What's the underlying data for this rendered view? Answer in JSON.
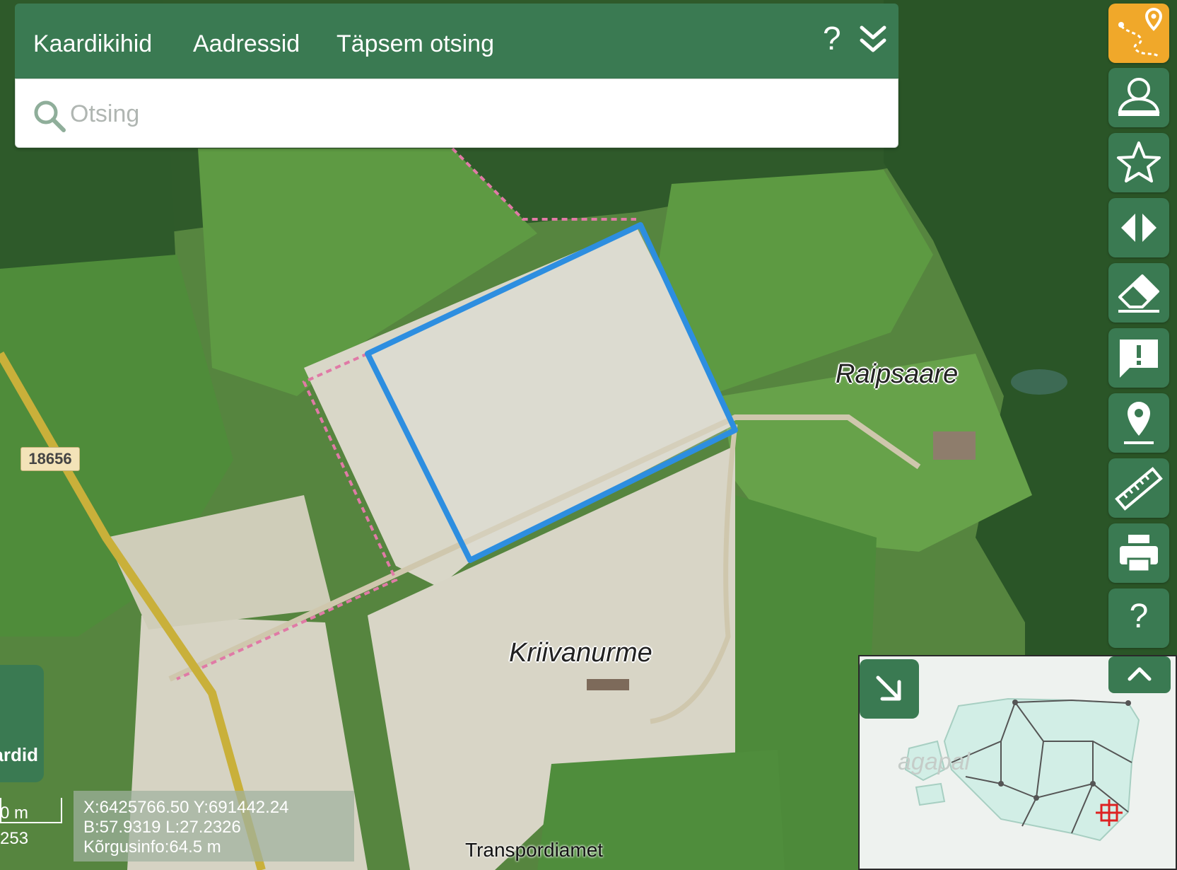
{
  "header": {
    "tabs": [
      {
        "label": "Kaardikihid"
      },
      {
        "label": "Aadressid"
      },
      {
        "label": "Täpsem otsing"
      }
    ],
    "help_label": "?"
  },
  "search": {
    "placeholder": "Otsing"
  },
  "toolbar": {
    "tools": [
      {
        "icon": "route-pin-icon",
        "active": true
      },
      {
        "icon": "user-icon"
      },
      {
        "icon": "star-icon"
      },
      {
        "icon": "compare-arrows-icon"
      },
      {
        "icon": "eraser-icon"
      },
      {
        "icon": "feedback-icon"
      },
      {
        "icon": "location-pin-icon"
      },
      {
        "icon": "ruler-icon"
      },
      {
        "icon": "print-icon"
      },
      {
        "icon": "help-icon",
        "label": "?"
      }
    ]
  },
  "map": {
    "place_labels": [
      "Raipsaare",
      "Kriivanurme"
    ],
    "road_number": "18656",
    "attribution": "Transpordiamet"
  },
  "cards_button": {
    "label": "ardid"
  },
  "scale": {
    "label": "0 m",
    "ratio": "253"
  },
  "coordinates": {
    "xy": "X:6425766.50 Y:691442.24",
    "bl": "B:57.9319 L:27.2326",
    "height": "Kõrgusinfo:64.5 m"
  },
  "minimap": {
    "label": "agapal"
  },
  "colors": {
    "panel_green": "#3a7a52",
    "accent_orange": "#f0a82a",
    "selection_blue": "#2d8ee0"
  }
}
